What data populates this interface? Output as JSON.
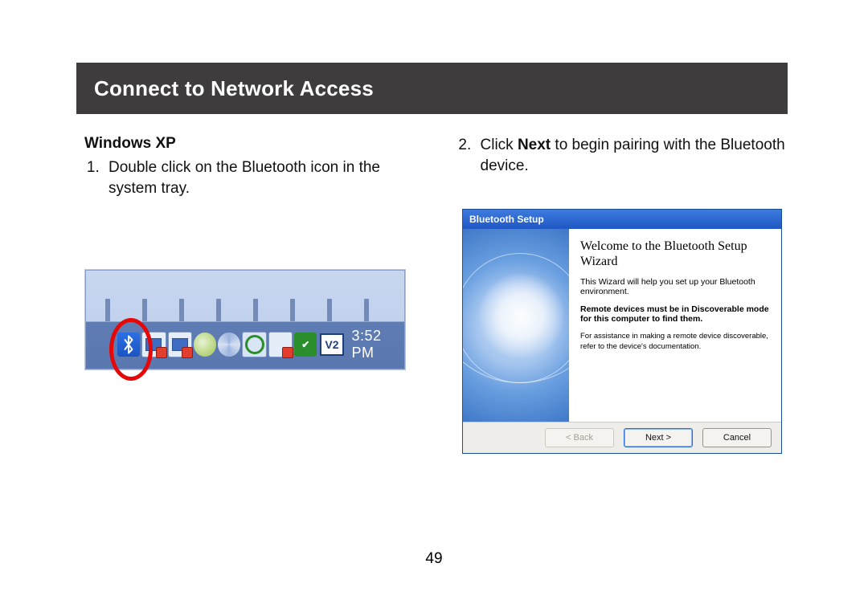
{
  "page_number": "49",
  "title": "Connect to Network Access",
  "left": {
    "os_heading": "Windows XP",
    "step1": "Double click on the Bluetooth icon in the system tray.",
    "tray": {
      "clock": "3:52 PM",
      "vnc_badge": "V2",
      "bluetooth_icon_name": "bluetooth-icon"
    }
  },
  "right": {
    "step2_prefix": "Click ",
    "step2_bold": "Next",
    "step2_suffix": " to begin pairing with the Bluetooth device.",
    "wizard": {
      "titlebar": "Bluetooth Setup",
      "heading": "Welcome to the Bluetooth Setup Wizard",
      "line1": "This Wizard will help you set up your Bluetooth environment.",
      "line2": "Remote devices must be in Discoverable mode for this computer to find them.",
      "line3": "For assistance in making a remote device discoverable, refer to the device's documentation.",
      "btn_back": "< Back",
      "btn_next": "Next >",
      "btn_cancel": "Cancel"
    }
  }
}
